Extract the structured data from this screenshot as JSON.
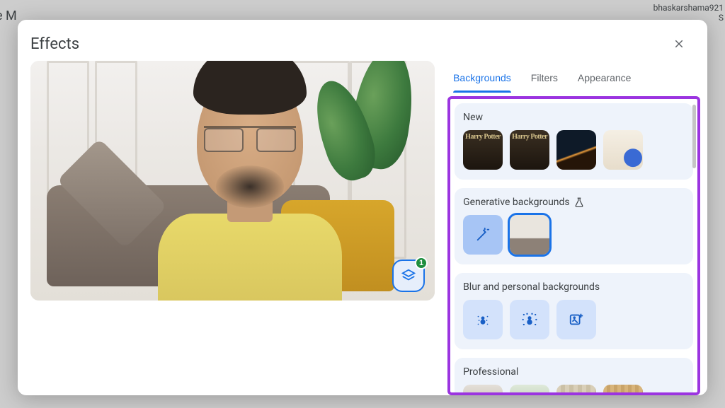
{
  "behind": {
    "left_fragment": "e M",
    "right_fragment_top": "bhaskarshama921",
    "right_fragment_bottom": "S"
  },
  "modal": {
    "title": "Effects",
    "effects_badge_count": "1"
  },
  "tabs": {
    "backgrounds": "Backgrounds",
    "filters": "Filters",
    "appearance": "Appearance"
  },
  "sections": {
    "new": {
      "title": "New",
      "tiles": [
        {
          "name": "bg-harry-potter-1",
          "label": "Harry Potter"
        },
        {
          "name": "bg-harry-potter-2",
          "label": "Harry Potter"
        },
        {
          "name": "bg-dark-fireplace",
          "label": ""
        },
        {
          "name": "bg-colorful-room",
          "label": ""
        }
      ]
    },
    "generative": {
      "title": "Generative backgrounds"
    },
    "blur": {
      "title": "Blur and personal backgrounds"
    },
    "professional": {
      "title": "Professional"
    }
  }
}
